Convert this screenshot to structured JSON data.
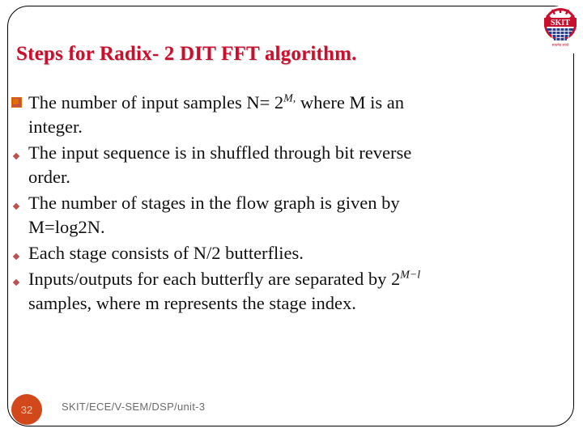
{
  "slide": {
    "title": "Steps for Radix- 2 DIT FFT algorithm.",
    "title_color": "#C8102E",
    "background_color": "#FFFFFF",
    "border_color": "#000000"
  },
  "logo": {
    "name": "skit-logo",
    "wordmark": "SKIT",
    "tagline": "सत्यमेव जयते",
    "primary_color": "#C8102E",
    "secondary_color": "#2B3E8C"
  },
  "bullets": [
    {
      "marker": "square-box-glyph",
      "lines": [
        "The number of input samples N= 2",
        "integer."
      ],
      "superscript": "M,",
      "line1_tail": " where M is an",
      "justify": true
    },
    {
      "marker": "diamond-bullet",
      "lines": [
        "The input sequence is in shuffled through bit reverse",
        "order."
      ],
      "justify": true
    },
    {
      "marker": "diamond-bullet",
      "lines": [
        "The number of stages in the flow graph is given by",
        "M=log2N."
      ],
      "italic_tokens": [
        "N"
      ],
      "justify": true
    },
    {
      "marker": "diamond-bullet",
      "lines": [
        "Each stage consists of N/2 butterflies."
      ],
      "justify": false
    },
    {
      "marker": "diamond-bullet",
      "lines": [
        "Inputs/outputs for each butterfly are separated by 2",
        "samples, where m represents the stage index."
      ],
      "superscript": "M−l",
      "justify": true
    }
  ],
  "footer": {
    "page_number": "32",
    "page_badge_color": "#D2481B",
    "path_text": "SKIT/ECE/V-SEM/DSP/unit-3"
  }
}
